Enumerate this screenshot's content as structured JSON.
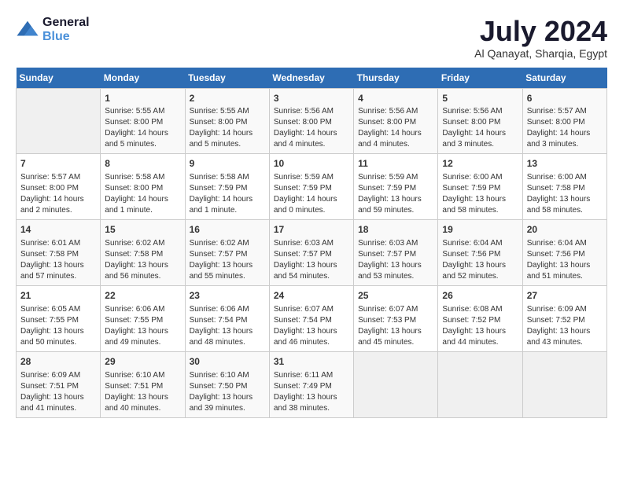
{
  "logo": {
    "line1": "General",
    "line2": "Blue"
  },
  "title": "July 2024",
  "location": "Al Qanayat, Sharqia, Egypt",
  "days_of_week": [
    "Sunday",
    "Monday",
    "Tuesday",
    "Wednesday",
    "Thursday",
    "Friday",
    "Saturday"
  ],
  "weeks": [
    [
      {
        "day": "",
        "info": ""
      },
      {
        "day": "1",
        "info": "Sunrise: 5:55 AM\nSunset: 8:00 PM\nDaylight: 14 hours\nand 5 minutes."
      },
      {
        "day": "2",
        "info": "Sunrise: 5:55 AM\nSunset: 8:00 PM\nDaylight: 14 hours\nand 5 minutes."
      },
      {
        "day": "3",
        "info": "Sunrise: 5:56 AM\nSunset: 8:00 PM\nDaylight: 14 hours\nand 4 minutes."
      },
      {
        "day": "4",
        "info": "Sunrise: 5:56 AM\nSunset: 8:00 PM\nDaylight: 14 hours\nand 4 minutes."
      },
      {
        "day": "5",
        "info": "Sunrise: 5:56 AM\nSunset: 8:00 PM\nDaylight: 14 hours\nand 3 minutes."
      },
      {
        "day": "6",
        "info": "Sunrise: 5:57 AM\nSunset: 8:00 PM\nDaylight: 14 hours\nand 3 minutes."
      }
    ],
    [
      {
        "day": "7",
        "info": "Sunrise: 5:57 AM\nSunset: 8:00 PM\nDaylight: 14 hours\nand 2 minutes."
      },
      {
        "day": "8",
        "info": "Sunrise: 5:58 AM\nSunset: 8:00 PM\nDaylight: 14 hours\nand 1 minute."
      },
      {
        "day": "9",
        "info": "Sunrise: 5:58 AM\nSunset: 7:59 PM\nDaylight: 14 hours\nand 1 minute."
      },
      {
        "day": "10",
        "info": "Sunrise: 5:59 AM\nSunset: 7:59 PM\nDaylight: 14 hours\nand 0 minutes."
      },
      {
        "day": "11",
        "info": "Sunrise: 5:59 AM\nSunset: 7:59 PM\nDaylight: 13 hours\nand 59 minutes."
      },
      {
        "day": "12",
        "info": "Sunrise: 6:00 AM\nSunset: 7:59 PM\nDaylight: 13 hours\nand 58 minutes."
      },
      {
        "day": "13",
        "info": "Sunrise: 6:00 AM\nSunset: 7:58 PM\nDaylight: 13 hours\nand 58 minutes."
      }
    ],
    [
      {
        "day": "14",
        "info": "Sunrise: 6:01 AM\nSunset: 7:58 PM\nDaylight: 13 hours\nand 57 minutes."
      },
      {
        "day": "15",
        "info": "Sunrise: 6:02 AM\nSunset: 7:58 PM\nDaylight: 13 hours\nand 56 minutes."
      },
      {
        "day": "16",
        "info": "Sunrise: 6:02 AM\nSunset: 7:57 PM\nDaylight: 13 hours\nand 55 minutes."
      },
      {
        "day": "17",
        "info": "Sunrise: 6:03 AM\nSunset: 7:57 PM\nDaylight: 13 hours\nand 54 minutes."
      },
      {
        "day": "18",
        "info": "Sunrise: 6:03 AM\nSunset: 7:57 PM\nDaylight: 13 hours\nand 53 minutes."
      },
      {
        "day": "19",
        "info": "Sunrise: 6:04 AM\nSunset: 7:56 PM\nDaylight: 13 hours\nand 52 minutes."
      },
      {
        "day": "20",
        "info": "Sunrise: 6:04 AM\nSunset: 7:56 PM\nDaylight: 13 hours\nand 51 minutes."
      }
    ],
    [
      {
        "day": "21",
        "info": "Sunrise: 6:05 AM\nSunset: 7:55 PM\nDaylight: 13 hours\nand 50 minutes."
      },
      {
        "day": "22",
        "info": "Sunrise: 6:06 AM\nSunset: 7:55 PM\nDaylight: 13 hours\nand 49 minutes."
      },
      {
        "day": "23",
        "info": "Sunrise: 6:06 AM\nSunset: 7:54 PM\nDaylight: 13 hours\nand 48 minutes."
      },
      {
        "day": "24",
        "info": "Sunrise: 6:07 AM\nSunset: 7:54 PM\nDaylight: 13 hours\nand 46 minutes."
      },
      {
        "day": "25",
        "info": "Sunrise: 6:07 AM\nSunset: 7:53 PM\nDaylight: 13 hours\nand 45 minutes."
      },
      {
        "day": "26",
        "info": "Sunrise: 6:08 AM\nSunset: 7:52 PM\nDaylight: 13 hours\nand 44 minutes."
      },
      {
        "day": "27",
        "info": "Sunrise: 6:09 AM\nSunset: 7:52 PM\nDaylight: 13 hours\nand 43 minutes."
      }
    ],
    [
      {
        "day": "28",
        "info": "Sunrise: 6:09 AM\nSunset: 7:51 PM\nDaylight: 13 hours\nand 41 minutes."
      },
      {
        "day": "29",
        "info": "Sunrise: 6:10 AM\nSunset: 7:51 PM\nDaylight: 13 hours\nand 40 minutes."
      },
      {
        "day": "30",
        "info": "Sunrise: 6:10 AM\nSunset: 7:50 PM\nDaylight: 13 hours\nand 39 minutes."
      },
      {
        "day": "31",
        "info": "Sunrise: 6:11 AM\nSunset: 7:49 PM\nDaylight: 13 hours\nand 38 minutes."
      },
      {
        "day": "",
        "info": ""
      },
      {
        "day": "",
        "info": ""
      },
      {
        "day": "",
        "info": ""
      }
    ]
  ]
}
